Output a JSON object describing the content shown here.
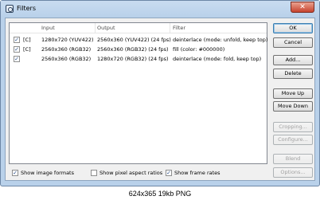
{
  "window": {
    "title": "Filters",
    "close_symbol": "✕"
  },
  "table": {
    "headers": [
      "Input",
      "Output",
      "Filter"
    ],
    "rows": [
      {
        "checked": true,
        "tag": "[C]",
        "input": "1280x720 (YUV422)",
        "output": "2560x360 (YUV422) (24 fps)",
        "filter": "deinterlace (mode: unfold, keep top)"
      },
      {
        "checked": true,
        "tag": "[C]",
        "input": "2560x360 (RGB32)",
        "output": "2560x360 (RGB32) (24 fps)",
        "filter": "fill (color: #000000)"
      },
      {
        "checked": true,
        "tag": "",
        "input": "2560x360 (RGB32)",
        "output": "1280x720 (RGB32) (24 fps)",
        "filter": "deinterlace (mode: fold, keep top)"
      }
    ]
  },
  "buttons": {
    "ok": "OK",
    "cancel": "Cancel",
    "add": "Add...",
    "delete": "Delete",
    "move_up": "Move Up",
    "move_down": "Move Down",
    "cropping": "Cropping...",
    "configure": "Configure...",
    "blend": "Blend",
    "options": "Options..."
  },
  "options": {
    "show_image_formats": {
      "label": "Show image formats",
      "checked": true
    },
    "show_pixel_aspect_ratios": {
      "label": "Show pixel aspect ratios",
      "checked": false
    },
    "show_frame_rates": {
      "label": "Show frame rates",
      "checked": true
    }
  },
  "caption": "624x365 19kb PNG",
  "colors": {
    "window_frame": "#b9d1ea",
    "close_button": "#c7432e",
    "dialog_bg": "#f0f0f0"
  },
  "icons": {
    "app": "filters-app-icon",
    "close": "close-icon",
    "check": "checkmark"
  }
}
